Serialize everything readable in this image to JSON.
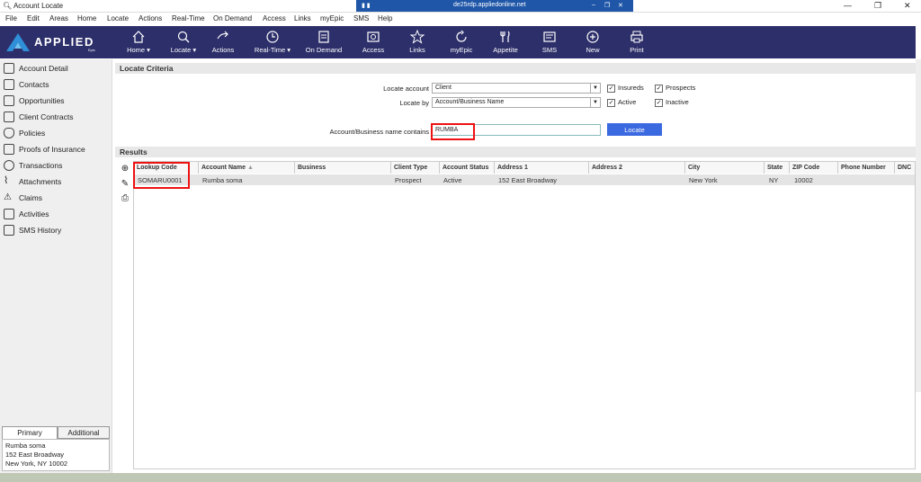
{
  "window": {
    "title": "Account Locate",
    "rdp_host": "de25rdp.appliedonline.net"
  },
  "menu": [
    "File",
    "Edit",
    "Areas",
    "Home",
    "Locate",
    "Actions",
    "Real-Time",
    "On Demand",
    "Access",
    "Links",
    "myEpic",
    "SMS",
    "Help"
  ],
  "brand": {
    "name": "APPLIED",
    "sub": "Epic"
  },
  "nav": [
    {
      "label": "Home",
      "icon": "home-icon",
      "dropdown": true
    },
    {
      "label": "Locate",
      "icon": "search-icon",
      "dropdown": true
    },
    {
      "label": "Actions",
      "icon": "actions-icon",
      "dropdown": false
    },
    {
      "label": "Real-Time",
      "icon": "clock-icon",
      "dropdown": true
    },
    {
      "label": "On Demand",
      "icon": "document-icon",
      "dropdown": false
    },
    {
      "label": "Access",
      "icon": "access-icon",
      "dropdown": false
    },
    {
      "label": "Links",
      "icon": "star-icon",
      "dropdown": false
    },
    {
      "label": "myEpic",
      "icon": "refresh-icon",
      "dropdown": false
    },
    {
      "label": "Appetite",
      "icon": "fork-knife-icon",
      "dropdown": false
    },
    {
      "label": "SMS",
      "icon": "sms-icon",
      "dropdown": false
    },
    {
      "label": "New",
      "icon": "plus-circle-icon",
      "dropdown": false
    },
    {
      "label": "Print",
      "icon": "print-icon",
      "dropdown": false
    }
  ],
  "sidebar": {
    "items": [
      "Account Detail",
      "Contacts",
      "Opportunities",
      "Client Contracts",
      "Policies",
      "Proofs of Insurance",
      "Transactions",
      "Attachments",
      "Claims",
      "Activities",
      "SMS History"
    ],
    "tabs": [
      "Primary",
      "Additional"
    ],
    "address": [
      "Rumba soma",
      "152 East Broadway",
      "New York, NY  10002"
    ]
  },
  "criteria": {
    "header": "Locate Criteria",
    "locate_account_label": "Locate account",
    "locate_account_value": "Client",
    "locate_by_label": "Locate by",
    "locate_by_value": "Account/Business Name",
    "insureds": "Insureds",
    "prospects": "Prospects",
    "active": "Active",
    "inactive": "Inactive",
    "name_contains_label": "Account/Business name contains",
    "name_contains_value": "RUMBA",
    "locate_button": "Locate"
  },
  "results": {
    "header": "Results",
    "columns": [
      "Lookup Code",
      "Account Name",
      "Business",
      "Client Type",
      "Account Status",
      "Address 1",
      "Address 2",
      "City",
      "State",
      "ZIP Code",
      "Phone Number",
      "DNC"
    ],
    "sort_indicator": "▲",
    "rows": [
      [
        "SOMARU0001",
        "Rumba soma",
        "",
        "Prospect",
        "Active",
        "152 East Broadway",
        "",
        "New York",
        "NY",
        "10002",
        "",
        ""
      ]
    ]
  }
}
